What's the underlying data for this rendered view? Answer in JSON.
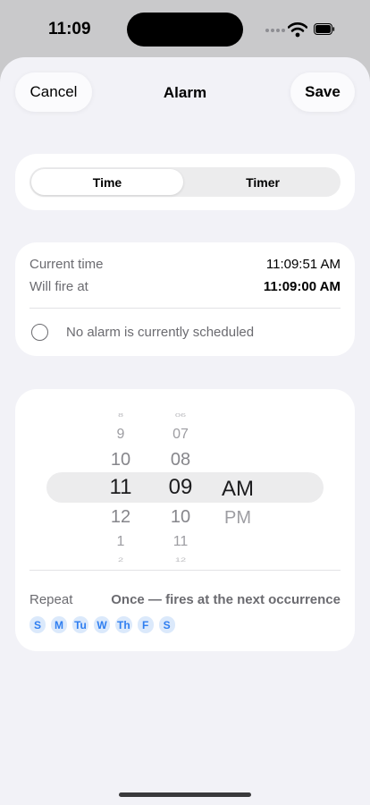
{
  "status_bar": {
    "time": "11:09"
  },
  "nav": {
    "cancel_label": "Cancel",
    "title": "Alarm",
    "save_label": "Save"
  },
  "mode_tabs": [
    {
      "label": "Time",
      "selected": true
    },
    {
      "label": "Timer",
      "selected": false
    }
  ],
  "info": {
    "current_time_label": "Current time",
    "current_time_value": "11:09:51 AM",
    "fire_label": "Will fire at",
    "fire_value": "11:09:00 AM",
    "status_text": "No alarm is currently scheduled"
  },
  "picker": {
    "hours": [
      "8",
      "9",
      "10",
      "11",
      "12",
      "1",
      "2"
    ],
    "minutes": [
      "06",
      "07",
      "08",
      "09",
      "10",
      "11",
      "12"
    ],
    "selected_hour": "11",
    "selected_minute": "09",
    "periods": [
      "AM",
      "PM"
    ],
    "selected_period": "AM"
  },
  "repeat": {
    "label": "Repeat",
    "value": "Once — fires at the next occurrence",
    "days": [
      "S",
      "M",
      "Tu",
      "W",
      "Th",
      "F",
      "S"
    ]
  },
  "colors": {
    "accent": "#2f7ef0",
    "day_chip_bg": "#dbe9fb",
    "sheet_bg": "#f2f2f7"
  }
}
